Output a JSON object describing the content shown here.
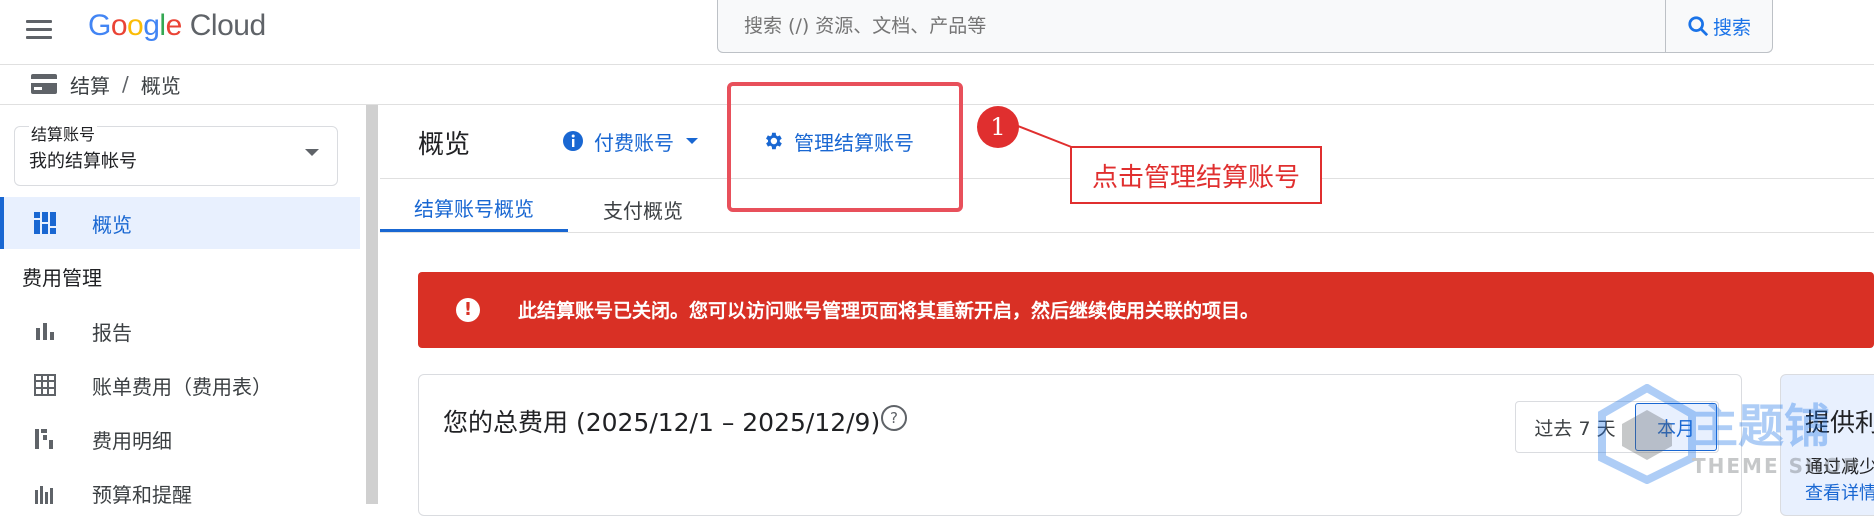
{
  "header": {
    "logo_google": [
      "G",
      "o",
      "o",
      "g",
      "l",
      "e"
    ],
    "logo_cloud": "Cloud",
    "search_placeholder": "搜索 (/) 资源、文档、产品等",
    "search_button": "搜索"
  },
  "breadcrumb": {
    "root": "结算",
    "current": "概览"
  },
  "sidebar": {
    "account_label": "结算账号",
    "account_value": "我的结算帐号",
    "overview": "概览",
    "section_cost": "费用管理",
    "items": [
      {
        "label": "报告",
        "icon": "bar-chart-icon"
      },
      {
        "label": "账单费用（费用表）",
        "icon": "table-icon"
      },
      {
        "label": "费用明细",
        "icon": "breakdown-icon"
      },
      {
        "label": "预算和提醒",
        "icon": "budget-icon"
      }
    ]
  },
  "main": {
    "title": "概览",
    "paying_account": "付费账号",
    "manage_account": "管理结算账号",
    "tabs": [
      "结算账号概览",
      "支付概览"
    ],
    "alert": "此结算账号已关闭。您可以访问账号管理页面将其重新开启，然后继续使用关联的项目。",
    "cost_title": "您的总费用 (2025/12/1 – 2025/12/9)",
    "range_7": "过去 7 天",
    "range_month": "本月",
    "side_title": "提供利",
    "side_sub": "通过减少",
    "side_link": "查看详情"
  },
  "annotation": {
    "number": "1",
    "label": "点击管理结算账号"
  },
  "watermark": {
    "brand": "主题铺",
    "sub": "THEME SHOP"
  },
  "colors": {
    "accent": "#1967d2",
    "alert": "#d93025",
    "annotation": "#e02f2f"
  }
}
